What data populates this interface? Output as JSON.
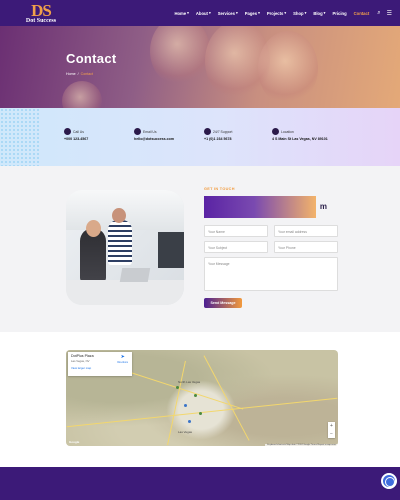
{
  "brand": {
    "mark": "DS",
    "name": "Dot Success"
  },
  "nav": {
    "items": [
      {
        "label": "Home",
        "caret": "▾",
        "active": false
      },
      {
        "label": "About",
        "caret": "▾",
        "active": false
      },
      {
        "label": "Services",
        "caret": "▾",
        "active": false
      },
      {
        "label": "Pages",
        "caret": "▾",
        "active": false
      },
      {
        "label": "Projects",
        "caret": "▾",
        "active": false
      },
      {
        "label": "Shop",
        "caret": "▾",
        "active": false
      },
      {
        "label": "Blog",
        "caret": "▾",
        "active": false
      },
      {
        "label": "Pricing",
        "caret": "",
        "active": false
      },
      {
        "label": "Contact",
        "caret": "",
        "active": true
      }
    ],
    "search_icon": "⌕",
    "menu_icon": "☰"
  },
  "hero": {
    "title": "Contact",
    "breadcrumb": {
      "home": "Home",
      "sep": "/",
      "current": "Contact"
    }
  },
  "info": [
    {
      "label": "Call Us",
      "value": "+000 123-4567"
    },
    {
      "label": "Email Us",
      "value": "hello@dotsuccess.com"
    },
    {
      "label": "24/7 Support",
      "value": "+1 (0)1 234 5678"
    },
    {
      "label": "Location",
      "value": "4 S Main St Las Vegas, NV 89101"
    }
  ],
  "contact": {
    "eyebrow": "GET IN TOUCH",
    "title_tail": "m",
    "name_placeholder": "Your Name",
    "email_placeholder": "Your email address",
    "subject_placeholder": "Your Subject",
    "phone_placeholder": "Your Phone",
    "message_placeholder": "Your Message",
    "send_label": "Send Message"
  },
  "map": {
    "place": "DotPlus Plaza",
    "place_sub": "Las Vegas, NV",
    "larger_link": "View larger map",
    "directions": "Directions",
    "city_label": "Las Vegas",
    "north": "North Las Vegas",
    "zoom_in": "+",
    "zoom_out": "−",
    "attribution": "Keyboard shortcuts  Map data ©2024 Google  Terms  Report a map error",
    "google": "Google"
  }
}
